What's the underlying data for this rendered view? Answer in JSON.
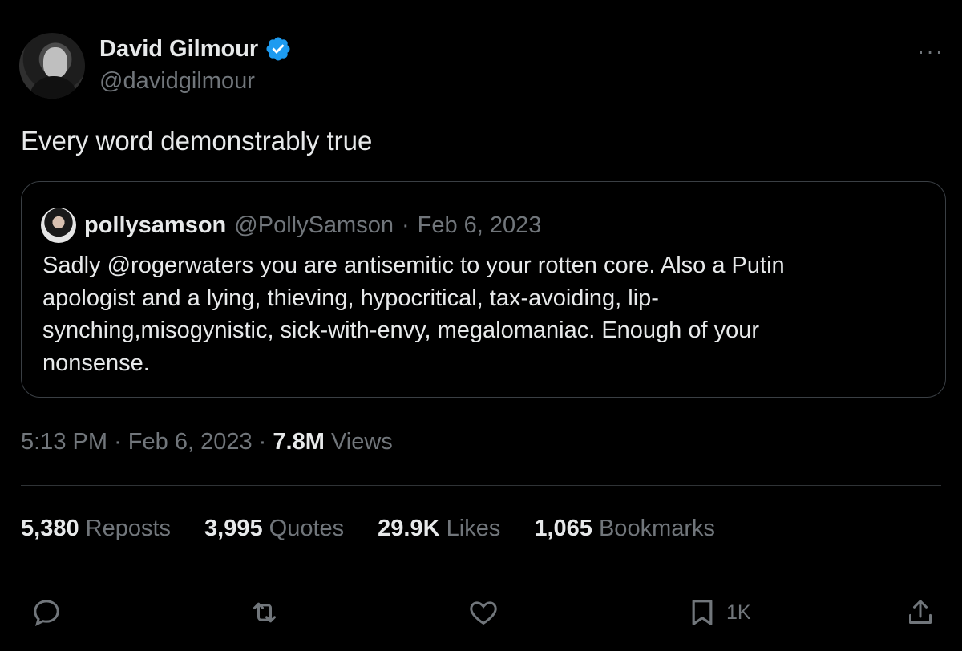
{
  "author": {
    "name": "David Gilmour",
    "handle": "@davidgilmour",
    "verified_color": "#1d9bf0"
  },
  "more_label": "···",
  "tweet": {
    "text": "Every word demonstrably true"
  },
  "quoted": {
    "name": "pollysamson",
    "handle": "@PollySamson",
    "separator": "·",
    "date": "Feb 6, 2023",
    "lines": [
      "Sadly @rogerwaters you are antisemitic to your rotten core. Also a Putin",
      "apologist and a lying, thieving, hypocritical, tax-avoiding, lip-",
      "synching,misogynistic, sick-with-envy, megalomaniac. Enough of your",
      "nonsense."
    ]
  },
  "meta": {
    "time": "5:13 PM",
    "separator": "·",
    "date": "Feb 6, 2023",
    "views_count": "7.8M",
    "views_label": "Views"
  },
  "stats": [
    {
      "count": "5,380",
      "label": "Reposts"
    },
    {
      "count": "3,995",
      "label": "Quotes"
    },
    {
      "count": "29.9K",
      "label": "Likes"
    },
    {
      "count": "1,065",
      "label": "Bookmarks"
    }
  ],
  "actions": {
    "reply": {
      "icon": "reply-icon"
    },
    "repost": {
      "icon": "repost-icon"
    },
    "like": {
      "icon": "heart-icon"
    },
    "bookmark": {
      "icon": "bookmark-icon",
      "count": "1K"
    },
    "share": {
      "icon": "share-icon"
    }
  }
}
